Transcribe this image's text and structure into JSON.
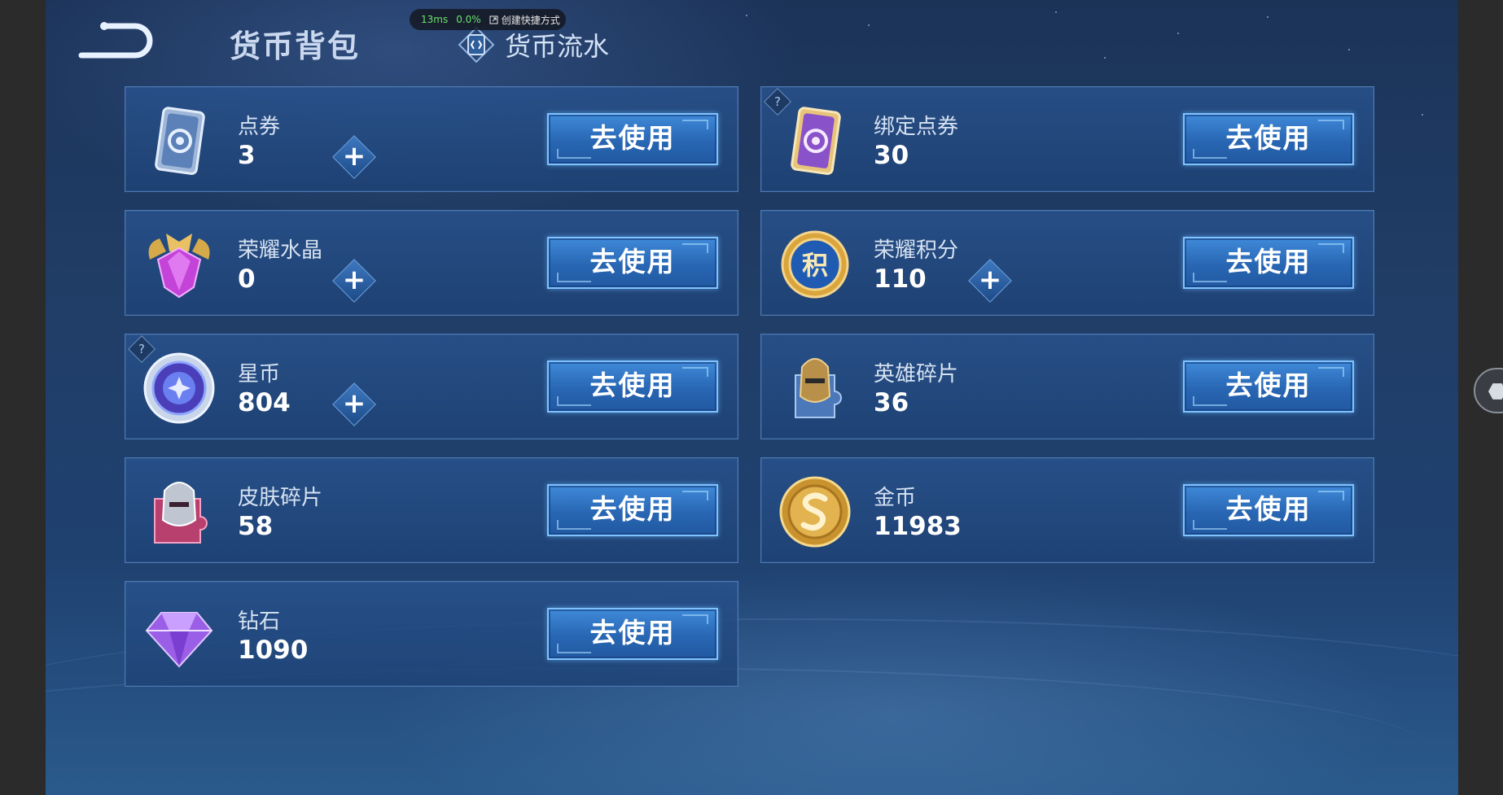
{
  "overlay": {
    "latency": "13ms",
    "percent": "0.0%",
    "shortcut_label": "创建快捷方式"
  },
  "header": {
    "title": "货币背包",
    "flow_link_label": "货币流水"
  },
  "currencies": [
    {
      "name": "点券",
      "value": "3",
      "icon": "coupon-icon",
      "has_plus": true,
      "has_help": false,
      "button": "去使用"
    },
    {
      "name": "绑定点券",
      "value": "30",
      "icon": "bound-coupon-icon",
      "has_plus": false,
      "has_help": true,
      "button": "去使用"
    },
    {
      "name": "荣耀水晶",
      "value": "0",
      "icon": "glory-crystal-icon",
      "has_plus": true,
      "has_help": false,
      "button": "去使用"
    },
    {
      "name": "荣耀积分",
      "value": "110",
      "icon": "glory-points-icon",
      "has_plus": true,
      "has_help": false,
      "button": "去使用"
    },
    {
      "name": "星币",
      "value": "804",
      "icon": "star-coin-icon",
      "has_plus": true,
      "has_help": true,
      "button": "去使用"
    },
    {
      "name": "英雄碎片",
      "value": "36",
      "icon": "hero-fragment-icon",
      "has_plus": false,
      "has_help": false,
      "button": "去使用"
    },
    {
      "name": "皮肤碎片",
      "value": "58",
      "icon": "skin-fragment-icon",
      "has_plus": false,
      "has_help": false,
      "button": "去使用"
    },
    {
      "name": "金币",
      "value": "11983",
      "icon": "gold-coin-icon",
      "has_plus": false,
      "has_help": false,
      "button": "去使用"
    },
    {
      "name": "钻石",
      "value": "1090",
      "icon": "diamond-icon",
      "has_plus": false,
      "has_help": false,
      "button": "去使用"
    }
  ],
  "help_symbol": "?",
  "plus_symbol": "+",
  "points_glyph": "积",
  "colors": {
    "accent_button": "#2f75c8",
    "card_border": "#4d79b3",
    "background": "#203d66"
  }
}
